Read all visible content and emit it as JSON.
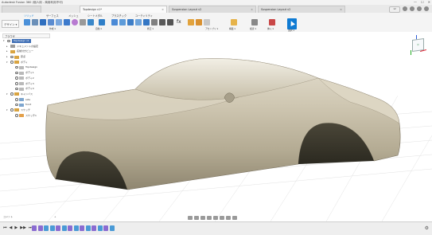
{
  "window": {
    "title": "Autodesk Fusion 360 (個人用 - 商用利用不可)",
    "controls": [
      "—",
      "☐",
      "✕"
    ]
  },
  "tabs": [
    {
      "label": "Topdesign v1*",
      "active": false
    },
    {
      "label": "Suspension Layout v2",
      "active": false
    },
    {
      "label": "Suspension Layout v2",
      "active": false
    }
  ],
  "header_right": {
    "online_label": "12"
  },
  "ribbon_tabs": [
    {
      "label": "ソリッド",
      "active": true
    },
    {
      "label": "サーフェス",
      "active": false
    },
    {
      "label": "メッシュ",
      "active": false
    },
    {
      "label": "シートメタル",
      "active": false
    },
    {
      "label": "プラスチック",
      "active": false
    },
    {
      "label": "ユーティリティ",
      "active": false
    }
  ],
  "ribbon_groups": [
    {
      "label": "作成 ▾"
    },
    {
      "label": "自動 ▾"
    },
    {
      "label": "修正 ▾"
    },
    {
      "label": "アセンブリ ▾"
    },
    {
      "label": "構築 ▾"
    },
    {
      "label": "検査 ▾"
    },
    {
      "label": "挿入 ▾"
    },
    {
      "label": "選択 ▾"
    }
  ],
  "workspace": {
    "label": "デザイン ▾"
  },
  "browser": {
    "title": "ブラウザ",
    "items": [
      {
        "label": "Topdesign v1",
        "indent": 0,
        "kind": "root"
      },
      {
        "label": "ドキュメントの設定",
        "indent": 1,
        "kind": "settings"
      },
      {
        "label": "名前付きビュー",
        "indent": 1,
        "kind": "folder"
      },
      {
        "label": "原点",
        "indent": 1,
        "kind": "folder"
      },
      {
        "label": "ボディ",
        "indent": 1,
        "kind": "folder"
      },
      {
        "label": "Topdesign",
        "indent": 2,
        "kind": "body"
      },
      {
        "label": "ボディ1",
        "indent": 2,
        "kind": "body"
      },
      {
        "label": "ボディ2",
        "indent": 2,
        "kind": "body"
      },
      {
        "label": "ボディ3",
        "indent": 2,
        "kind": "body"
      },
      {
        "label": "ボディ4",
        "indent": 2,
        "kind": "body"
      },
      {
        "label": "キャンバス",
        "indent": 1,
        "kind": "folder"
      },
      {
        "label": "side",
        "indent": 2,
        "kind": "canvas"
      },
      {
        "label": "front",
        "indent": 2,
        "kind": "canvas"
      },
      {
        "label": "スケッチ",
        "indent": 1,
        "kind": "folder"
      },
      {
        "label": "スケッチ1",
        "indent": 2,
        "kind": "sketch"
      }
    ]
  },
  "viewcube": {
    "face": "前"
  },
  "comments": {
    "label": "コメント",
    "plus": "+"
  },
  "timeline": {
    "controls": [
      "⏮",
      "◀",
      "▶",
      "▶▶",
      "⏭"
    ],
    "features": [
      "#8a6bd1",
      "#8a6bd1",
      "#4a9ad6",
      "#4a9ad6",
      "#8a6bd1",
      "#4a9ad6",
      "#8a6bd1",
      "#4a9ad6",
      "#8a6bd1",
      "#4a9ad6",
      "#8a6bd1",
      "#4a9ad6",
      "#8a6bd1",
      "#4a9ad6"
    ],
    "settings_icon": "gear-icon"
  },
  "colors": {
    "accent": "#0f7bd3",
    "body_surface": "#cfc7b2",
    "grid": "#d9d9d9"
  }
}
